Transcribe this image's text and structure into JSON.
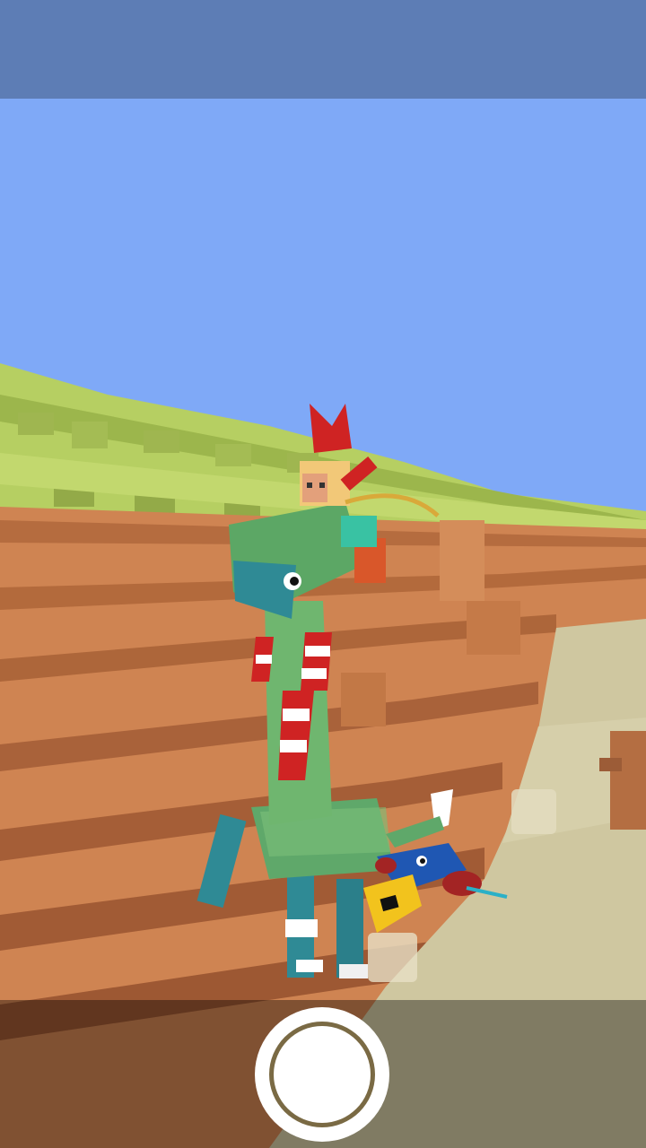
{
  "app": {
    "screen": "camera-photo-mode"
  },
  "scene": {
    "description_icons": [
      "giraffe-creature",
      "rider-character",
      "toucan-creature"
    ],
    "colors": {
      "sky": "#7fa9f7",
      "top_bar": "#5d7db5",
      "grass": "#b6cf62",
      "terrain": "#cf8452",
      "ground": "#cfc7a0",
      "creature_green": "#5fa86a",
      "creature_teal": "#2f8a95",
      "rider_red": "#cf2323",
      "toucan_blue": "#1f57b3",
      "toucan_yellow": "#f2c31d"
    }
  },
  "controls": {
    "shutter_icon": "shutter-button-icon"
  }
}
